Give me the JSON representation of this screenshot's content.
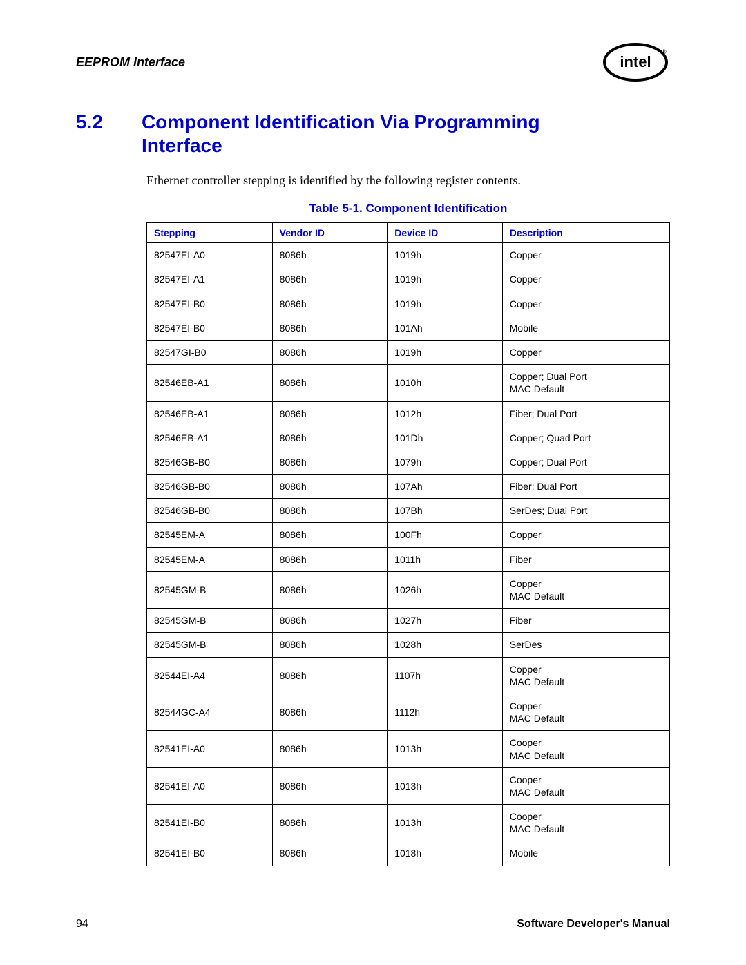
{
  "header": {
    "title": "EEPROM Interface"
  },
  "section": {
    "number": "5.2",
    "title": "Component Identification Via Programming Interface"
  },
  "paragraph": "Ethernet controller stepping is identified by the following register contents.",
  "table": {
    "caption": "Table 5-1. Component Identification",
    "headers": {
      "stepping": "Stepping",
      "vendor": "Vendor ID",
      "device": "Device ID",
      "description": "Description"
    },
    "rows": [
      {
        "stepping": "82547EI-A0",
        "vendor": "8086h",
        "device": "1019h",
        "description": "Copper"
      },
      {
        "stepping": "82547EI-A1",
        "vendor": "8086h",
        "device": "1019h",
        "description": "Copper"
      },
      {
        "stepping": "82547EI-B0",
        "vendor": "8086h",
        "device": "1019h",
        "description": "Copper"
      },
      {
        "stepping": "82547EI-B0",
        "vendor": "8086h",
        "device": "101Ah",
        "description": "Mobile"
      },
      {
        "stepping": "82547GI-B0",
        "vendor": "8086h",
        "device": "1019h",
        "description": "Copper"
      },
      {
        "stepping": "82546EB-A1",
        "vendor": "8086h",
        "device": "1010h",
        "description": "Copper; Dual Port\nMAC Default"
      },
      {
        "stepping": "82546EB-A1",
        "vendor": "8086h",
        "device": "1012h",
        "description": "Fiber; Dual Port"
      },
      {
        "stepping": "82546EB-A1",
        "vendor": "8086h",
        "device": "101Dh",
        "description": "Copper; Quad Port"
      },
      {
        "stepping": "82546GB-B0",
        "vendor": "8086h",
        "device": "1079h",
        "description": "Copper; Dual Port"
      },
      {
        "stepping": "82546GB-B0",
        "vendor": "8086h",
        "device": "107Ah",
        "description": "Fiber; Dual Port"
      },
      {
        "stepping": "82546GB-B0",
        "vendor": "8086h",
        "device": "107Bh",
        "description": "SerDes; Dual Port"
      },
      {
        "stepping": "82545EM-A",
        "vendor": "8086h",
        "device": "100Fh",
        "description": "Copper"
      },
      {
        "stepping": "82545EM-A",
        "vendor": "8086h",
        "device": "1011h",
        "description": "Fiber"
      },
      {
        "stepping": "82545GM-B",
        "vendor": "8086h",
        "device": "1026h",
        "description": "Copper\nMAC Default"
      },
      {
        "stepping": "82545GM-B",
        "vendor": "8086h",
        "device": "1027h",
        "description": "Fiber"
      },
      {
        "stepping": "82545GM-B",
        "vendor": "8086h",
        "device": "1028h",
        "description": "SerDes"
      },
      {
        "stepping": "82544EI-A4",
        "vendor": "8086h",
        "device": "1107h",
        "description": "Copper\nMAC Default"
      },
      {
        "stepping": "82544GC-A4",
        "vendor": "8086h",
        "device": "1112h",
        "description": "Copper\nMAC Default"
      },
      {
        "stepping": "82541EI-A0",
        "vendor": "8086h",
        "device": "1013h",
        "description": "Cooper\nMAC Default"
      },
      {
        "stepping": "82541EI-A0",
        "vendor": "8086h",
        "device": "1013h",
        "description": "Cooper\nMAC Default"
      },
      {
        "stepping": "82541EI-B0",
        "vendor": "8086h",
        "device": "1013h",
        "description": "Cooper\nMAC Default"
      },
      {
        "stepping": "82541EI-B0",
        "vendor": "8086h",
        "device": "1018h",
        "description": "Mobile"
      }
    ]
  },
  "footer": {
    "page": "94",
    "doc": "Software Developer's Manual"
  }
}
